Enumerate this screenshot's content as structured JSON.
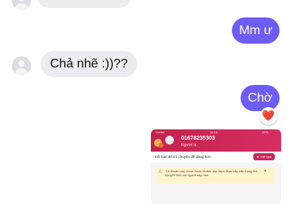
{
  "messages": {
    "out_1": {
      "text": "Mm ư"
    },
    "in_1": {
      "text": "Chả nhẽ :))??"
    },
    "out_2": {
      "text": "Chờ",
      "reaction": "❤️"
    }
  },
  "colors": {
    "outgoing": "#6e5cf5",
    "incoming": "#ececf0",
    "accent_pink": "#c9275a"
  },
  "attachment": {
    "status_carrier": "Viettel",
    "status_time": "16:19",
    "status_battery": "26%",
    "phone": "01678235303",
    "subtitle": "Người lạ",
    "friend_prompt": "Kết bạn để trò chuyện dễ dàng hơn",
    "friend_button": "Kết bạn",
    "warning": "Tài khoản này chưa được MoMo xác thực. Bạn hãy cẩn trọng khi chuyển tiền với người này nha.",
    "warning_icon": "warning-triangle-icon",
    "close_icon": "close-icon"
  }
}
